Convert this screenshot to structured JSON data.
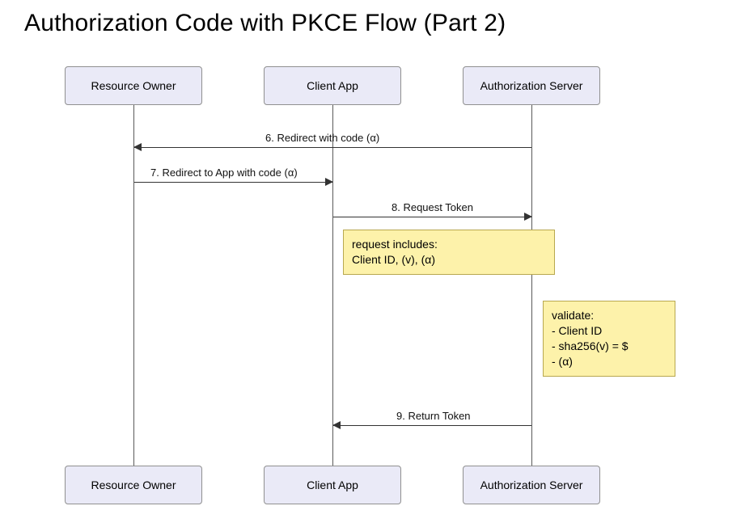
{
  "title": "Authorization Code with PKCE Flow (Part 2)",
  "actors": {
    "resource_owner": "Resource Owner",
    "client_app": "Client App",
    "auth_server": "Authorization Server"
  },
  "messages": {
    "m6": "6. Redirect with code (α)",
    "m7": "7. Redirect to App with code (α)",
    "m8": "8. Request Token",
    "m9": "9. Return Token"
  },
  "notes": {
    "request": {
      "line1": "request includes:",
      "line2": "Client ID, (v), (α)"
    },
    "validate": {
      "line1": "validate:",
      "line2": "- Client ID",
      "line3": "- sha256(v) = $",
      "line4": "- (α)"
    }
  }
}
